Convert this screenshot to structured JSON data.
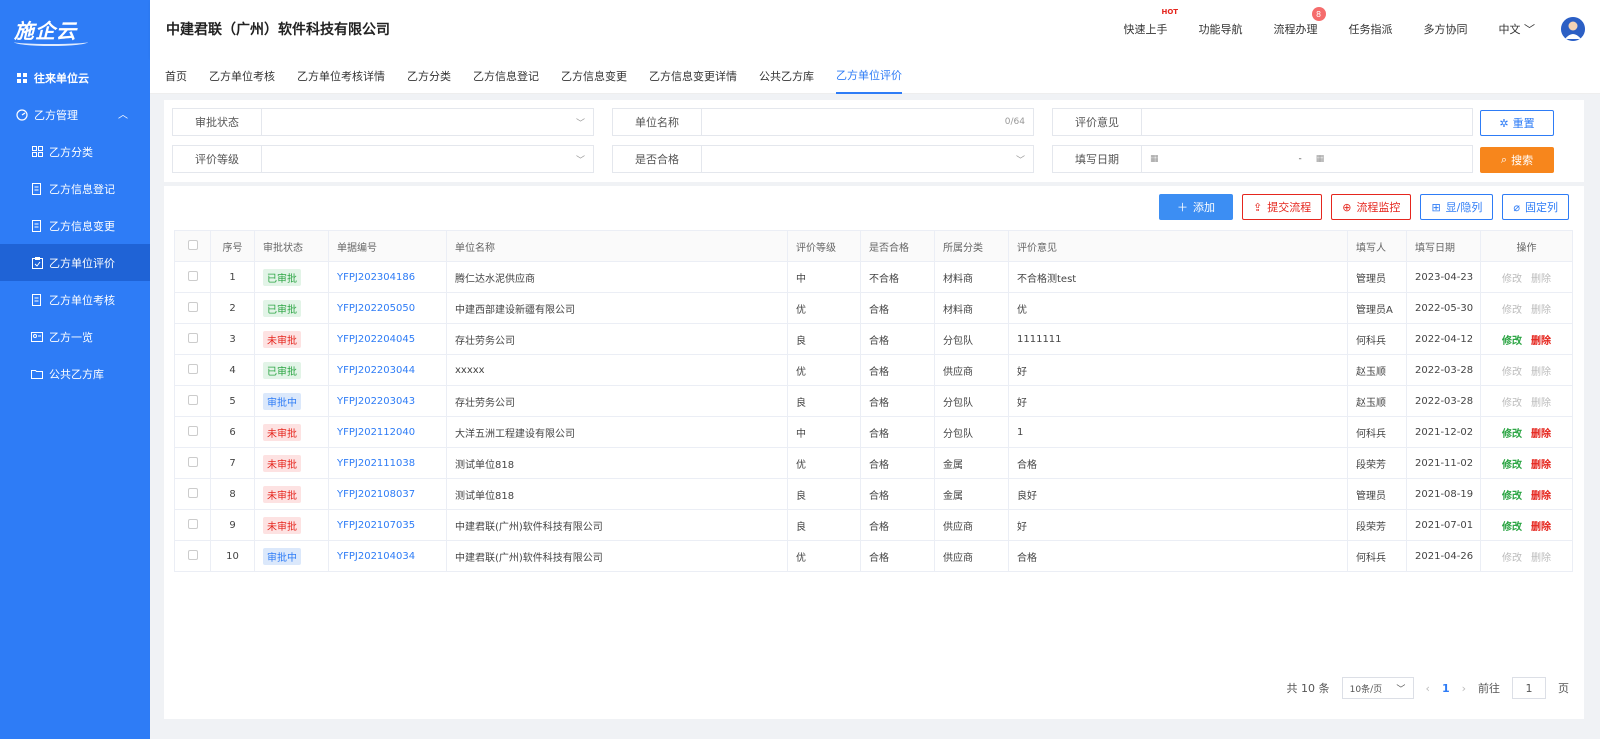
{
  "brand": {
    "logo": "施企云"
  },
  "sidebar": {
    "items": [
      {
        "label": "往来单位云",
        "icon": "grid-icon"
      },
      {
        "label": "乙方管理",
        "icon": "gauge-icon"
      },
      {
        "label": "乙方分类",
        "icon": "apps-icon"
      },
      {
        "label": "乙方信息登记",
        "icon": "doc-edit-icon"
      },
      {
        "label": "乙方信息变更",
        "icon": "doc-change-icon"
      },
      {
        "label": "乙方单位评价",
        "icon": "clipboard-check-icon"
      },
      {
        "label": "乙方单位考核",
        "icon": "doc-check-icon"
      },
      {
        "label": "乙方一览",
        "icon": "id-card-icon"
      },
      {
        "label": "公共乙方库",
        "icon": "folder-icon"
      }
    ]
  },
  "header": {
    "company": "中建君联（广州）软件科技有限公司",
    "nav": [
      "快速上手",
      "功能导航",
      "流程办理",
      "任务指派",
      "多方协同"
    ],
    "hot_label": "HOT",
    "badge_count": "8",
    "language": "中文"
  },
  "tabs": [
    "首页",
    "乙方单位考核",
    "乙方单位考核详情",
    "乙方分类",
    "乙方信息登记",
    "乙方信息变更",
    "乙方信息变更详情",
    "公共乙方库",
    "乙方单位评价"
  ],
  "filter": {
    "approval_label": "审批状态",
    "unit_name_label": "单位名称",
    "unit_name_counter": "0/64",
    "comment_label": "评价意见",
    "grade_label": "评价等级",
    "qualified_label": "是否合格",
    "date_label": "填写日期",
    "date_sep": "-",
    "reset_label": "重置",
    "search_label": "搜索"
  },
  "toolbar": {
    "add": "添加",
    "submit": "提交流程",
    "monitor": "流程监控",
    "toggle": "显/隐列",
    "fix": "固定列"
  },
  "table": {
    "headers": [
      "",
      "序号",
      "审批状态",
      "单据编号",
      "单位名称",
      "评价等级",
      "是否合格",
      "所属分类",
      "评价意见",
      "填写人",
      "填写日期",
      "操作"
    ],
    "edit_label": "修改",
    "delete_label": "删除",
    "rows": [
      {
        "no": "1",
        "status": "已审批",
        "st": "ok",
        "code": "YFPJ202304186",
        "name": "腾仁达水泥供应商",
        "grade": "中",
        "qualified": "不合格",
        "category": "材料商",
        "comment": "不合格测test",
        "writer": "管理员",
        "date": "2023-04-23",
        "ops": "dis"
      },
      {
        "no": "2",
        "status": "已审批",
        "st": "ok",
        "code": "YFPJ202205050",
        "name": "中建西部建设新疆有限公司",
        "grade": "优",
        "qualified": "合格",
        "category": "材料商",
        "comment": "优",
        "writer": "管理员A",
        "date": "2022-05-30",
        "ops": "dis"
      },
      {
        "no": "3",
        "status": "未审批",
        "st": "no",
        "code": "YFPJ202204045",
        "name": "存壮劳务公司",
        "grade": "良",
        "qualified": "合格",
        "category": "分包队",
        "comment": "1111111",
        "writer": "何科兵",
        "date": "2022-04-12",
        "ops": "act"
      },
      {
        "no": "4",
        "status": "已审批",
        "st": "ok",
        "code": "YFPJ202203044",
        "name": "xxxxx",
        "grade": "优",
        "qualified": "合格",
        "category": "供应商",
        "comment": "好",
        "writer": "赵玉顺",
        "date": "2022-03-28",
        "ops": "dis"
      },
      {
        "no": "5",
        "status": "审批中",
        "st": "mid",
        "code": "YFPJ202203043",
        "name": "存壮劳务公司",
        "grade": "良",
        "qualified": "合格",
        "category": "分包队",
        "comment": "好",
        "writer": "赵玉顺",
        "date": "2022-03-28",
        "ops": "dis"
      },
      {
        "no": "6",
        "status": "未审批",
        "st": "no",
        "code": "YFPJ202112040",
        "name": "大洋五洲工程建设有限公司",
        "grade": "中",
        "qualified": "合格",
        "category": "分包队",
        "comment": "1",
        "writer": "何科兵",
        "date": "2021-12-02",
        "ops": "act"
      },
      {
        "no": "7",
        "status": "未审批",
        "st": "no",
        "code": "YFPJ202111038",
        "name": "测试单位818",
        "grade": "优",
        "qualified": "合格",
        "category": "金属",
        "comment": "合格",
        "writer": "段荣芳",
        "date": "2021-11-02",
        "ops": "act"
      },
      {
        "no": "8",
        "status": "未审批",
        "st": "no",
        "code": "YFPJ202108037",
        "name": "测试单位818",
        "grade": "良",
        "qualified": "合格",
        "category": "金属",
        "comment": "良好",
        "writer": "管理员",
        "date": "2021-08-19",
        "ops": "act"
      },
      {
        "no": "9",
        "status": "未审批",
        "st": "no",
        "code": "YFPJ202107035",
        "name": "中建君联(广州)软件科技有限公司",
        "grade": "良",
        "qualified": "合格",
        "category": "供应商",
        "comment": "好",
        "writer": "段荣芳",
        "date": "2021-07-01",
        "ops": "act"
      },
      {
        "no": "10",
        "status": "审批中",
        "st": "mid",
        "code": "YFPJ202104034",
        "name": "中建君联(广州)软件科技有限公司",
        "grade": "优",
        "qualified": "合格",
        "category": "供应商",
        "comment": "合格",
        "writer": "何科兵",
        "date": "2021-04-26",
        "ops": "dis"
      }
    ]
  },
  "pager": {
    "total": "共 10 条",
    "page_size": "10条/页",
    "current": "1",
    "goto_label": "前往",
    "goto_value": "1",
    "page_suffix": "页"
  },
  "colors": {
    "primary": "#2e7cf6",
    "sidebar": "#2e7cf6",
    "search": "#f7861c",
    "danger": "#e5261e",
    "success": "#2ca544"
  }
}
